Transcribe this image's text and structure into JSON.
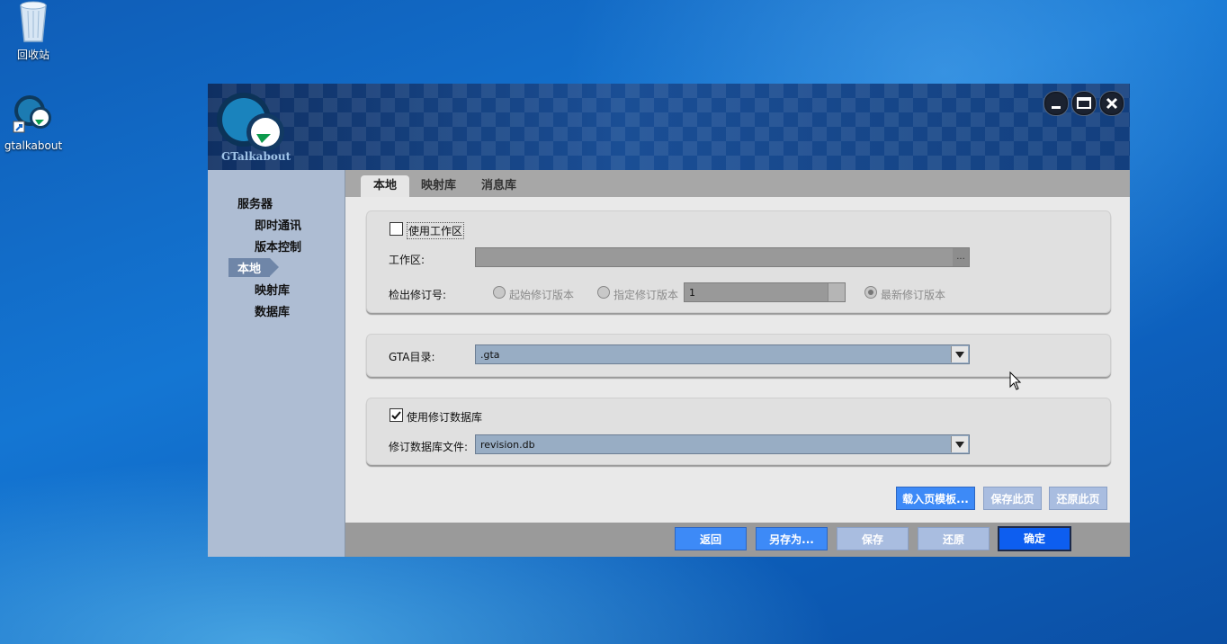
{
  "desktop": {
    "icons": [
      {
        "label": "回收站",
        "icon": "recycle-bin-icon"
      },
      {
        "label": "gtalkabout",
        "icon": "gtalkabout-app-icon"
      }
    ]
  },
  "window": {
    "logo_text": "GTalkabout",
    "controls": [
      "minimize-icon",
      "maximize-icon",
      "close-icon"
    ]
  },
  "sidebar": {
    "items": [
      {
        "label": "服务器",
        "level": 0,
        "active": false
      },
      {
        "label": "即时通讯",
        "level": 1,
        "active": false
      },
      {
        "label": "版本控制",
        "level": 1,
        "active": false
      },
      {
        "label": "本地",
        "level": 0,
        "active": true
      },
      {
        "label": "映射库",
        "level": 1,
        "active": false
      },
      {
        "label": "数据库",
        "level": 1,
        "active": false
      }
    ]
  },
  "tabs": [
    {
      "label": "本地",
      "active": true
    },
    {
      "label": "映射库",
      "active": false
    },
    {
      "label": "消息库",
      "active": false
    }
  ],
  "workspace": {
    "use_label": "使用工作区",
    "use_checked": false,
    "path_label": "工作区:",
    "path_value": "",
    "browse_label": "...",
    "checkout_label": "检出修订号:",
    "radio_start": "起始修订版本",
    "radio_specified": "指定修订版本",
    "revision_value": "1",
    "radio_latest": "最新修订版本",
    "selected_radio": "latest"
  },
  "gta": {
    "label": "GTA目录:",
    "value": ".gta"
  },
  "revision_db": {
    "use_label": "使用修订数据库",
    "use_checked": true,
    "file_label": "修订数据库文件:",
    "file_value": "revision.db"
  },
  "page_actions": {
    "load_template": "载入页模板...",
    "save_page": "保存此页",
    "restore_page": "还原此页"
  },
  "footer_actions": {
    "back": "返回",
    "save_as": "另存为...",
    "save": "保存",
    "restore": "还原",
    "ok": "确定"
  },
  "colors": {
    "accent_blue": "#3d8af7",
    "titlebar": "#133f7e",
    "sidebar": "#aebdd3"
  }
}
